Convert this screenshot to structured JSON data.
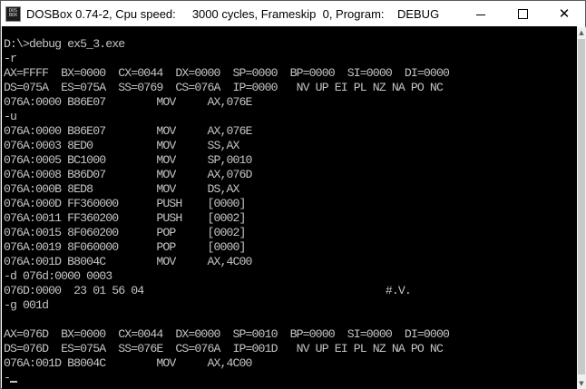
{
  "window": {
    "title": "DOSBox 0.74-2, Cpu speed:     3000 cycles, Frameskip  0, Program:    DEBUG",
    "icon_text_top": "DOS",
    "icon_text_bottom": "BOX",
    "controls": {
      "minimize": "minimize-icon",
      "maximize": "maximize-icon",
      "close": "✕"
    }
  },
  "console": {
    "lines": [
      "D:\\>debug ex5_3.exe",
      "-r",
      "AX=FFFF  BX=0000  CX=0044  DX=0000  SP=0000  BP=0000  SI=0000  DI=0000",
      "DS=075A  ES=075A  SS=0769  CS=076A  IP=0000   NV UP EI PL NZ NA PO NC",
      "076A:0000 B86E07        MOV     AX,076E",
      "-u",
      "076A:0000 B86E07        MOV     AX,076E",
      "076A:0003 8ED0          MOV     SS,AX",
      "076A:0005 BC1000        MOV     SP,0010",
      "076A:0008 B86D07        MOV     AX,076D",
      "076A:000B 8ED8          MOV     DS,AX",
      "076A:000D FF360000      PUSH    [0000]",
      "076A:0011 FF360200      PUSH    [0002]",
      "076A:0015 8F060200      POP     [0002]",
      "076A:0019 8F060000      POP     [0000]",
      "076A:001D B8004C        MOV     AX,4C00",
      "-d 076d:0000 0003",
      "076D:0000  23 01 56 04                                      #.V.",
      "-g 001d",
      "",
      "AX=076D  BX=0000  CX=0044  DX=0000  SP=0010  BP=0000  SI=0000  DI=0000",
      "DS=076D  ES=075A  SS=076E  CS=076A  IP=001D   NV UP EI PL NZ NA PO NC",
      "076A:001D B8004C        MOV     AX,4C00"
    ],
    "prompt": "-"
  },
  "colors": {
    "console_bg": "#000000",
    "console_fg": "#c4c4c4",
    "titlebar_bg": "#ffffff"
  }
}
